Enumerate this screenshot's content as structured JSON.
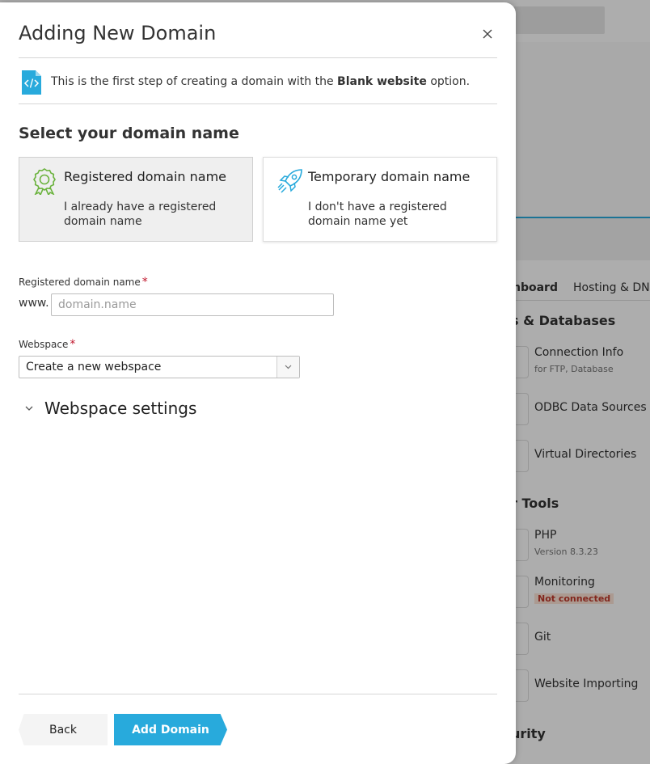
{
  "background": {
    "tabs": [
      "nboard",
      "Hosting & DNS"
    ],
    "sections": [
      "s & Databases",
      "r Tools",
      "urity"
    ],
    "items": [
      {
        "label": "Connection Info",
        "sub": "for FTP, Database",
        "color": "#6cb33f"
      },
      {
        "label": "ODBC Data Sources",
        "sub": "",
        "color": "#28aadc"
      },
      {
        "label": "Virtual Directories",
        "sub": "",
        "color": "#6cb33f"
      },
      {
        "label": "PHP",
        "sub": "Version 8.3.23",
        "color": "#6a5acd"
      },
      {
        "label": "Monitoring",
        "badge": "Not connected",
        "color": "#555555"
      },
      {
        "label": "Git",
        "sub": "",
        "color": "#e24e2f"
      },
      {
        "label": "Website Importing",
        "sub": "",
        "color": "#6cb33f"
      }
    ]
  },
  "dialog": {
    "title": "Adding New Domain",
    "info_prefix": "This is the first step of creating a domain with the ",
    "info_bold": "Blank website",
    "info_suffix": " option.",
    "section_title": "Select your domain name",
    "cards": [
      {
        "title": "Registered domain name",
        "desc": "I already have a registered domain name",
        "selected": true
      },
      {
        "title": "Temporary domain name",
        "desc": "I don't have a registered domain name yet",
        "selected": false
      }
    ],
    "domain_label": "Registered domain name",
    "required_mark": "*",
    "www_prefix": "www.",
    "domain_placeholder": "domain.name",
    "domain_value": "",
    "webspace_label": "Webspace",
    "webspace_value": "Create a new webspace",
    "webspace_settings": "Webspace settings",
    "back_label": "Back",
    "add_label": "Add Domain"
  },
  "colors": {
    "accent": "#28aadc",
    "green_icon": "#6cb33f",
    "required": "#c0152b"
  }
}
